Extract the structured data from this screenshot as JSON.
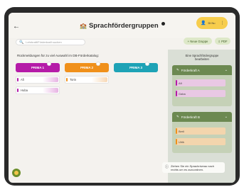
{
  "header": {
    "back_icon": "←",
    "title_icon": "🏫",
    "title": "Sprachfördergruppen",
    "user_chip": {
      "avatar_icon": "👤",
      "text": "Di Nu",
      "more_icon": "⋮"
    }
  },
  "toolbar": {
    "search_placeholder": "Lehrkraft/Förderkraft suchen",
    "new_group_label": "+ Neue Gruppe",
    "pdf_label": "⇩ PDF"
  },
  "intro_text": "Rückmeldungen für zu viel Auswahl im DB-Förderkatalog:",
  "categories": [
    {
      "label": "PRIMA 1",
      "color": "#b51ba8"
    },
    {
      "label": "PRIMA 2",
      "color": "#f0901a"
    },
    {
      "label": "PRIMA 3",
      "color": "#1ea3b6"
    }
  ],
  "cards": [
    {
      "label": "Afi",
      "bar": "#b51ba8",
      "fade": "#e7b3e3"
    },
    {
      "label": "Huba",
      "bar": "#b51ba8",
      "fade": "#e7b3e3"
    },
    {
      "label": "Torin",
      "bar": "#f0901a",
      "fade": "#f7d8b5"
    }
  ],
  "panel": {
    "heading": "Eine Sprachfördergruppe\nbearbeiten",
    "groups": [
      {
        "title": "Förderkraft A",
        "cards": [
          {
            "label": "Afi",
            "color": "#b51ba8",
            "bg": "#e9c8e4"
          },
          {
            "label": "Gaba",
            "color": "#b51ba8",
            "bg": "#e9c8e4"
          }
        ]
      },
      {
        "title": "Förderkraft B",
        "cards": [
          {
            "label": "Berli",
            "color": "#f0901a",
            "bg": "#f3d5ad"
          },
          {
            "label": "Ulrik",
            "color": "#f0901a",
            "bg": "#f3d5ad"
          }
        ]
      }
    ]
  },
  "snackbar": {
    "icon": "ⓘ",
    "text": "Ziehen Sie ein Sprachniveau nach\nrechts um es zuzuordnen."
  }
}
